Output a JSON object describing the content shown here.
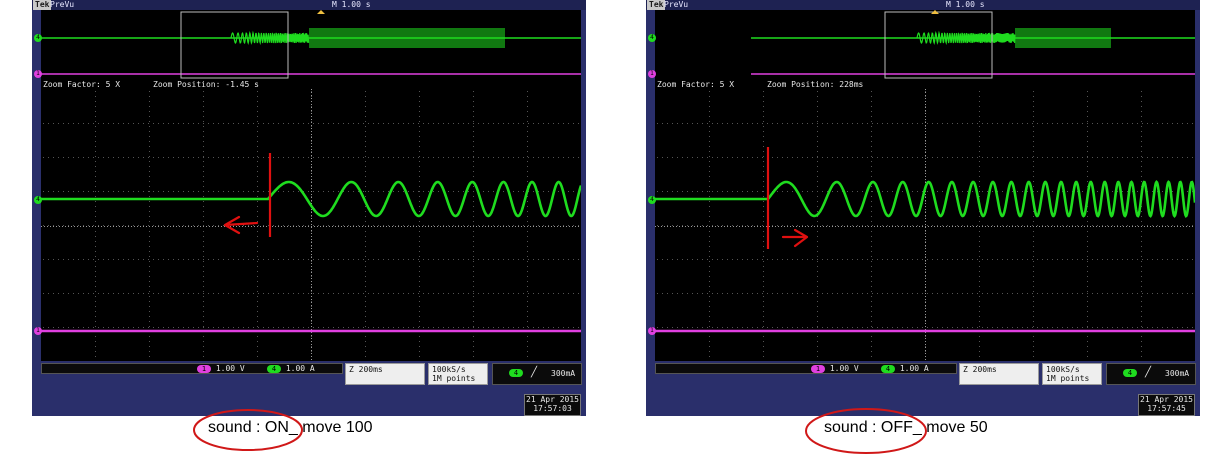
{
  "scopes": [
    {
      "brand": "Tek",
      "mode": "PreVu",
      "timebase": "M 1.00 s",
      "zoom_factor": "Zoom Factor: 5 X",
      "zoom_position": "Zoom Position: -1.45 s",
      "ch1_scale": "1.00 V",
      "ch4_scale": "1.00 A",
      "ch1_label": "1",
      "ch4_label": "4",
      "zoom_timebase": "Z 200ms",
      "sample_rate": "100kS/s",
      "record_length": "1M points",
      "trigger_channel": "4",
      "trigger_level": "300mA",
      "trigger_slope": "rising",
      "date": "21 Apr 2015",
      "time": "17:57:03",
      "caption": "sound : ON_ move 100",
      "marker_direction": "left",
      "colors": {
        "ch4": "#1fdc1f",
        "ch1": "#e040e0",
        "marker": "#e01010"
      }
    },
    {
      "brand": "Tek",
      "mode": "PreVu",
      "timebase": "M 1.00 s",
      "zoom_factor": "Zoom Factor: 5 X",
      "zoom_position": "Zoom Position: 228ms",
      "ch1_scale": "1.00 V",
      "ch4_scale": "1.00 A",
      "ch1_label": "1",
      "ch4_label": "4",
      "zoom_timebase": "Z 200ms",
      "sample_rate": "100kS/s",
      "record_length": "1M points",
      "trigger_channel": "4",
      "trigger_level": "300mA",
      "trigger_slope": "rising",
      "date": "21 Apr 2015",
      "time": "17:57:45",
      "caption": "sound : OFF_ move 50",
      "marker_direction": "right",
      "colors": {
        "ch4": "#1fdc1f",
        "ch1": "#e040e0",
        "marker": "#e01010"
      }
    }
  ]
}
